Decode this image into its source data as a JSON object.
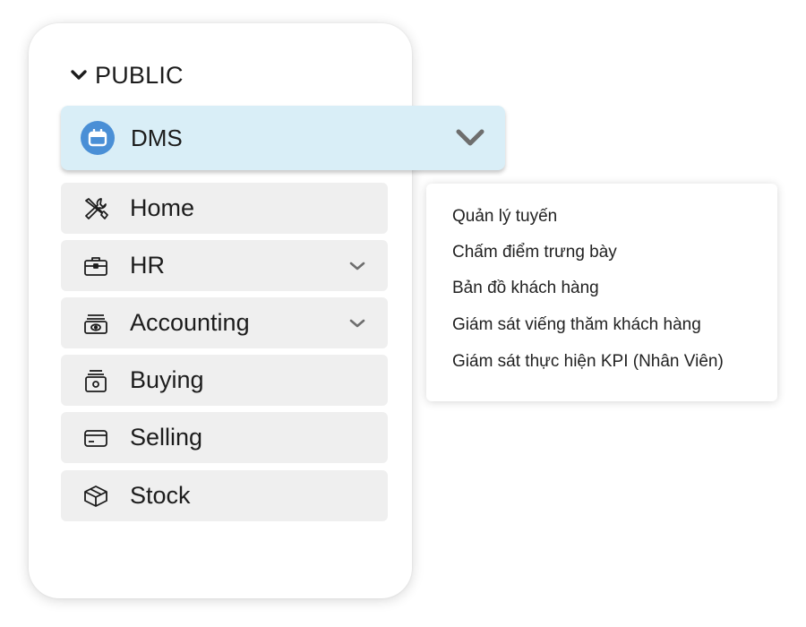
{
  "sidebar": {
    "section_title": "PUBLIC",
    "active_item": {
      "label": "DMS",
      "icon": "calendar-icon",
      "accent": "#4a8fd6",
      "background": "#d9eef7"
    },
    "items": [
      {
        "label": "Home",
        "icon": "tools-icon",
        "has_submenu": false
      },
      {
        "label": "HR",
        "icon": "briefcase-icon",
        "has_submenu": true
      },
      {
        "label": "Accounting",
        "icon": "cash-icon",
        "has_submenu": true
      },
      {
        "label": "Buying",
        "icon": "coin-box-icon",
        "has_submenu": false
      },
      {
        "label": "Selling",
        "icon": "card-icon",
        "has_submenu": false
      },
      {
        "label": "Stock",
        "icon": "box-icon",
        "has_submenu": false
      }
    ]
  },
  "dropdown": {
    "items": [
      "Quản lý tuyến",
      "Chấm điểm trưng bày",
      "Bản đồ khách hàng",
      "Giám sát viếng thăm khách hàng",
      "Giám sát thực hiện KPI (Nhân Viên)"
    ]
  }
}
